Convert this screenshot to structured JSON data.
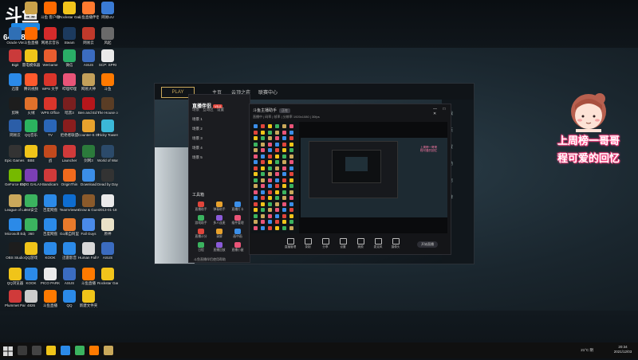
{
  "overlay": {
    "room_id": "6423804",
    "caption_line1": "上周榜一哥哥",
    "caption_line2": "程可爱的回忆"
  },
  "desktop_icons": [
    {
      "label": "小猪快大",
      "color": "#3b8ee8"
    },
    {
      "label": "Ashen",
      "color": "#caa24a"
    },
    {
      "label": "斗鱼 客户端",
      "color": "#ff6a00"
    },
    {
      "label": "Rockstar Games...",
      "color": "#f2c41b"
    },
    {
      "label": "斗鱼直播伴侣",
      "color": "#ff7a2f"
    },
    {
      "label": "网易UU",
      "color": "#3a7bd5"
    },
    {
      "label": "Oracle VM",
      "color": "#2f6fb5"
    },
    {
      "label": "斗鱼直播",
      "color": "#ff6a00"
    },
    {
      "label": "网易云音乐",
      "color": "#d52b2b"
    },
    {
      "label": "Steam",
      "color": "#1c3a5e"
    },
    {
      "label": "网易云",
      "color": "#c0392b"
    },
    {
      "label": "风起",
      "color": "#6a6a6a"
    },
    {
      "label": "Bigit",
      "color": "#ca3a3a"
    },
    {
      "label": "雷电模拟器",
      "color": "#f0c419"
    },
    {
      "label": "WeGame",
      "color": "#e85d2f"
    },
    {
      "label": "微信",
      "color": "#2aae67"
    },
    {
      "label": "ASUS",
      "color": "#3b6cc0"
    },
    {
      "label": "SCP: SPRI",
      "color": "#eaeaea"
    },
    {
      "label": "迅雷",
      "color": "#2b8ae8"
    },
    {
      "label": "腾讯视频",
      "color": "#ff5a2d"
    },
    {
      "label": "WPS 文字",
      "color": "#d9352b"
    },
    {
      "label": "哔哩哔哩",
      "color": "#e95478"
    },
    {
      "label": "网易大神",
      "color": "#c3a05a"
    },
    {
      "label": "斗鱼",
      "color": "#ff7a00"
    },
    {
      "label": "剪映",
      "color": "#1d1d1d"
    },
    {
      "label": "火绒",
      "color": "#e0712b"
    },
    {
      "label": "WPS Office",
      "color": "#d9352b"
    },
    {
      "label": "暗黑3",
      "color": "#7a1f1f"
    },
    {
      "label": "Ben and Ed Blood P...",
      "color": "#b5161b"
    },
    {
      "label": "The House of Da Vinci",
      "color": "#5a3d25"
    },
    {
      "label": "网易云",
      "color": "#2b5ea8"
    },
    {
      "label": "QQ音乐",
      "color": "#2bb35f"
    },
    {
      "label": "TV",
      "color": "#2a66b8"
    },
    {
      "label": "拒绝者联盟",
      "color": "#8a1d1d"
    },
    {
      "label": "Counter-S Global Of...",
      "color": "#e8a22d"
    },
    {
      "label": "Tricky Towers",
      "color": "#3bb8d8"
    },
    {
      "label": "Epic Games Launcher",
      "color": "#333333"
    },
    {
      "label": "BBE",
      "color": "#f0c419"
    },
    {
      "label": "战",
      "color": "#c2491d"
    },
    {
      "label": "Launcher",
      "color": "#d03a3a"
    },
    {
      "label": "剑网3",
      "color": "#2b7a3b"
    },
    {
      "label": "World of Warships",
      "color": "#2b4a6a"
    },
    {
      "label": "GeForce Experience",
      "color": "#76b900"
    },
    {
      "label": "GOG GALAXY",
      "color": "#7b3fb5"
    },
    {
      "label": "Bandicam",
      "color": "#d03a3a"
    },
    {
      "label": "OriginThin",
      "color": "#f06a1d"
    },
    {
      "label": "Download",
      "color": "#3b8ee8"
    },
    {
      "label": "Dead by Daylight",
      "color": "#333333"
    },
    {
      "label": "League of Legends",
      "color": "#c9a85b"
    },
    {
      "label": "360安全",
      "color": "#3bb35f"
    },
    {
      "label": "百度网盘",
      "color": "#2b8ae8"
    },
    {
      "label": "TeamViewer",
      "color": "#0e6dd0"
    },
    {
      "label": "Grow & Guess",
      "color": "#8a5a2b"
    },
    {
      "label": "2013-01-18",
      "color": "#eaeaea"
    },
    {
      "label": "Microsoft Edge",
      "color": "#2b8ae8"
    },
    {
      "label": "360",
      "color": "#3bb35f"
    },
    {
      "label": "百度网盘",
      "color": "#2b8ae8"
    },
    {
      "label": "Go来自阿里",
      "color": "#e87a2b"
    },
    {
      "label": "Fall Guys",
      "color": "#4a8ae8"
    },
    {
      "label": "原神",
      "color": "#eae2c8"
    },
    {
      "label": "OBS Studio",
      "color": "#1d1d1d"
    },
    {
      "label": "QQ游戏",
      "color": "#f0c419"
    },
    {
      "label": "KOOK",
      "color": "#2b8ae8"
    },
    {
      "label": "迅雷影音",
      "color": "#2b8ae8"
    },
    {
      "label": "Human Fall Flat",
      "color": "#d8d8d8"
    },
    {
      "label": "ASUS",
      "color": "#3b6cc0"
    },
    {
      "label": "QQ浏览器",
      "color": "#f0c419"
    },
    {
      "label": "KOOK",
      "color": "#2b8ae8"
    },
    {
      "label": "PICO PARK",
      "color": "#eaeaea"
    },
    {
      "label": "ASUS",
      "color": "#3b6cc0"
    },
    {
      "label": "斗鱼直播",
      "color": "#ff7a00"
    },
    {
      "label": "Rockstar Games",
      "color": "#f2c41b"
    },
    {
      "label": "Plummet Party",
      "color": "#d03a3a"
    },
    {
      "label": "4826",
      "color": "#cccccc"
    },
    {
      "label": "斗鱼直播",
      "color": "#ff7a00"
    },
    {
      "label": "QQ",
      "color": "#2b8ae8"
    },
    {
      "label": "新建文件夹",
      "color": "#f0c419"
    }
  ],
  "game_client": {
    "logo": "PLAY",
    "nav": [
      "主页",
      "云顶之弈",
      "联赛中心"
    ],
    "right_menu": [
      "游戏",
      "首页",
      "设置",
      "帮助",
      "商店",
      "推荐"
    ]
  },
  "obs": {
    "brand": "直播伴侣",
    "version": "V5.0",
    "scene_tabs": [
      "场景",
      "互动区",
      "设置"
    ],
    "scenes": [
      "场景 1",
      "场景 2",
      "场景 3",
      "场景 4",
      "场景 5"
    ],
    "toolbox_title": "工具箱",
    "tools": [
      "直播助手",
      "弹幕助手",
      "直播打卡",
      "游戏助手",
      "多人连麦",
      "插件管理",
      "直播计分",
      "录屏",
      "画中画",
      "日程",
      "直播回放",
      "直播小屋"
    ],
    "bottom_link": "斗鱼直播伴侣使用帮助",
    "main_title": "斗鱼主播助手",
    "main_pill": "正在",
    "sub_info": "直播中 | 码率 | 帧率 | 分辨率 1920x1080 | 30fps",
    "controls": [
      "直播管理",
      "录制",
      "分享",
      "设置",
      "美颜",
      "麦克风",
      "摄像头"
    ],
    "start_label": "开始直播",
    "window_controls": "— □ ✕"
  },
  "taskbar": {
    "temperature": "21°C 阴",
    "time": "20:34",
    "date": "2021/12/03"
  }
}
